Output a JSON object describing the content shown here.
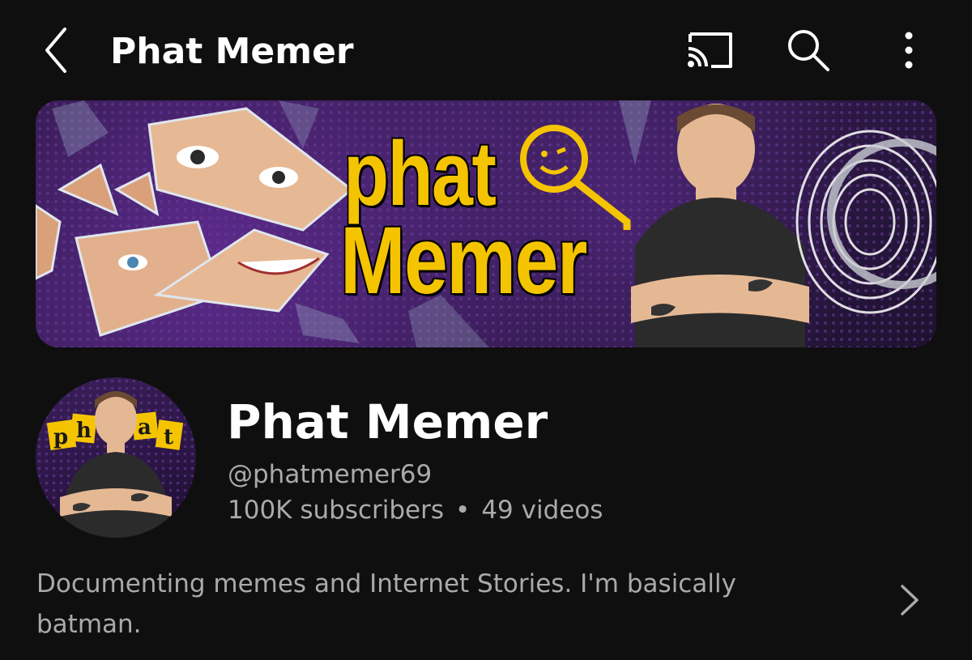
{
  "header": {
    "title": "Phat Memer",
    "icons": [
      "back-arrow-icon",
      "cast-icon",
      "search-icon",
      "more-vert-icon"
    ]
  },
  "banner": {
    "logo_line1": "phat",
    "logo_line2": "Memer",
    "accent_color": "#f5c400"
  },
  "channel": {
    "name": "Phat Memer",
    "handle": "@phatmemer69",
    "subscribers": "100K subscribers",
    "separator": "•",
    "videos": "49 videos",
    "avatar_letters": [
      "p",
      "h",
      "a",
      "t"
    ]
  },
  "description": {
    "text": "Documenting memes and Internet Stories. I'm basically batman."
  },
  "colors": {
    "background": "#0f0f0f",
    "primary_text": "#ffffff",
    "secondary_text": "#aaaaaa"
  }
}
